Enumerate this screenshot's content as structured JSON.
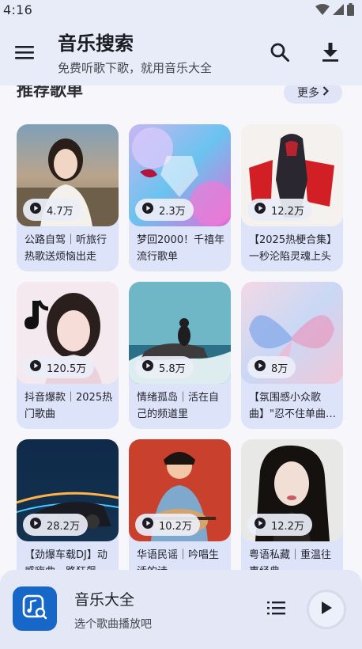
{
  "status_bar": {
    "time": "4:16",
    "icons": [
      "wifi-icon",
      "signal-icon",
      "battery-icon"
    ]
  },
  "header": {
    "title": "音乐搜索",
    "subtitle": "免费听歌下歌，就用音乐大全",
    "icons": [
      "menu-icon",
      "search-icon",
      "download-icon"
    ]
  },
  "section": {
    "title": "推荐歌单",
    "more_label": "更多"
  },
  "playlists": [
    {
      "title": "公路自驾｜听旅行热歌送烦恼出走",
      "plays": "4.7万"
    },
    {
      "title": "梦回2000！千禧年流行歌单",
      "plays": "2.3万"
    },
    {
      "title": "【2025热梗合集】一秒沦陷灵魂上头",
      "plays": "12.2万"
    },
    {
      "title": "抖音爆款｜2025热门歌曲",
      "plays": "120.5万"
    },
    {
      "title": "情绪孤岛｜活在自己的频道里",
      "plays": "5.8万"
    },
    {
      "title": "【氛围感小众歌曲】\"忍不住单曲循环\"",
      "plays": "8万"
    },
    {
      "title": "【劲爆车载DJ】动感嗨曲一路狂飙",
      "plays": "28.2万"
    },
    {
      "title": "华语民谣｜吟唱生活的诗",
      "plays": "10.2万"
    },
    {
      "title": "粤语私藏｜重温往事经典",
      "plays": "12.2万"
    }
  ],
  "player": {
    "title": "音乐大全",
    "subtitle": "选个歌曲播放吧",
    "icons": [
      "music-search-icon",
      "playlist-icon",
      "play-icon"
    ]
  },
  "colors": {
    "app_bar_bg": "#e8ecf8",
    "card_bg": "#dde3f9",
    "player_bg": "#e4e8f6",
    "accent": "#1667c7"
  }
}
